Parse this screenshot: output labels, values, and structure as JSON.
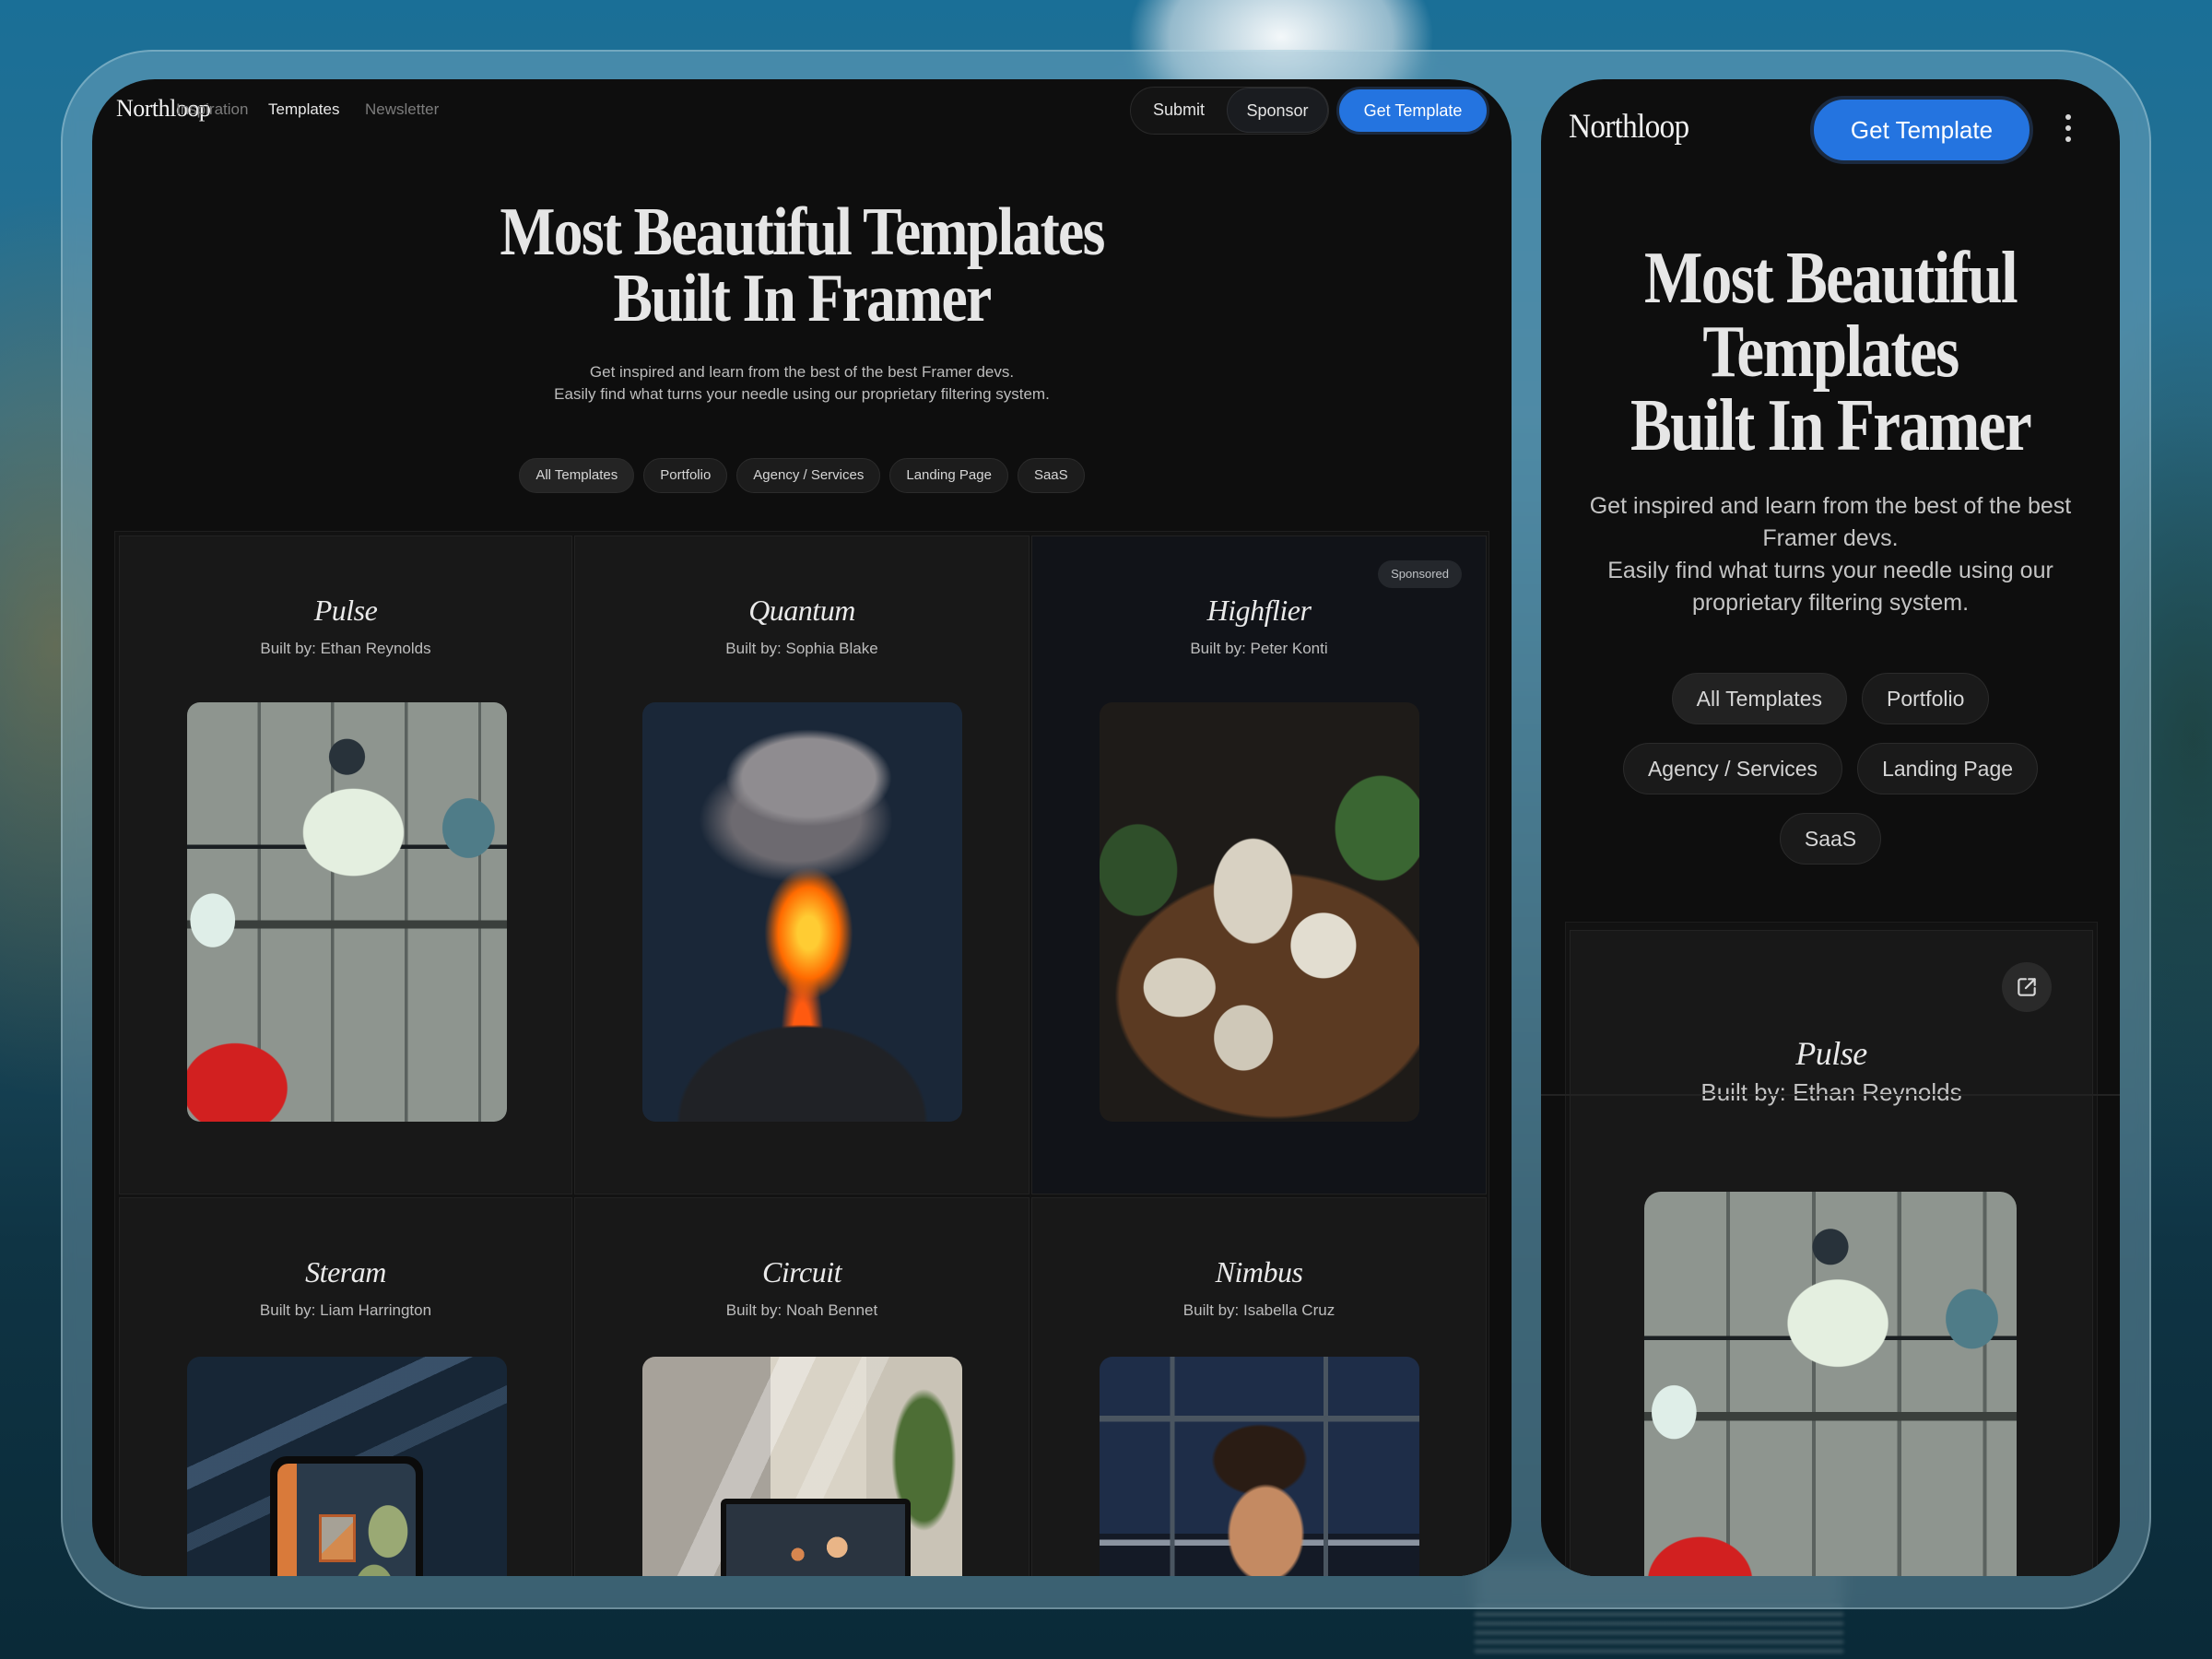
{
  "brand": "Northloop",
  "desktop": {
    "nav": {
      "links": [
        "Inspiration",
        "Templates",
        "Newsletter"
      ],
      "active_link": "Templates",
      "submit_label": "Submit",
      "sponsor_label": "Sponsor",
      "cta_label": "Get Template"
    },
    "hero": {
      "title_line1": "Most Beautiful Templates",
      "title_line2": "Built In Framer",
      "subtitle_line1": "Get inspired and learn from the best of the best Framer devs.",
      "subtitle_line2": "Easily find what turns your needle using our proprietary filtering system."
    },
    "filters": [
      "All Templates",
      "Portfolio",
      "Agency / Services",
      "Landing Page",
      "SaaS"
    ],
    "active_filter": "All Templates",
    "cards": [
      {
        "title": "Pulse",
        "author": "Built by: Ethan Reynolds",
        "image": "retro-control-panel"
      },
      {
        "title": "Quantum",
        "author": "Built by: Sophia Blake",
        "image": "erupting-volcano"
      },
      {
        "title": "Highflier",
        "author": "Built by: Peter Konti",
        "image": "vintage-calculators",
        "badge": "Sponsored"
      },
      {
        "title": "Steram",
        "author": "Built by: Liam Harrington",
        "image": "tablet-with-plants"
      },
      {
        "title": "Circuit",
        "author": "Built by: Noah Bennet",
        "image": "laptop-in-sunlit-room"
      },
      {
        "title": "Nimbus",
        "author": "Built by: Isabella Cruz",
        "image": "man-at-night-window"
      }
    ]
  },
  "mobile": {
    "cta_label": "Get Template",
    "menu_icon": "more-vertical-icon",
    "hero": {
      "title_line1": "Most Beautiful",
      "title_line2": "Templates",
      "title_line3": "Built In Framer",
      "subtitle": "Get inspired and learn from the best of the best Framer devs.",
      "subtitle_2": "Easily find what turns your needle using our proprietary filtering system."
    },
    "filters": [
      "All Templates",
      "Portfolio",
      "Agency / Services",
      "Landing Page",
      "SaaS"
    ],
    "active_filter": "All Templates",
    "card": {
      "title": "Pulse",
      "author": "Built by: Ethan Reynolds",
      "image": "retro-control-panel",
      "action_icon": "external-link-icon"
    }
  },
  "colors": {
    "accent": "#2474E0",
    "panel_bg": "#0E0E0E",
    "card_bg": "#181818",
    "sponsored_card_bg": "#111318"
  }
}
